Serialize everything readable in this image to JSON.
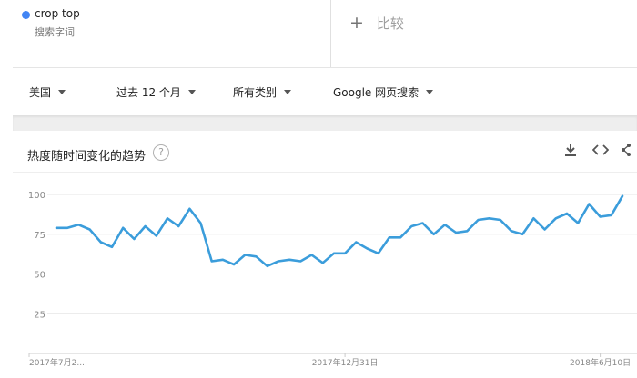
{
  "term": {
    "name": "crop top",
    "sub": "搜索字词",
    "color": "#4285f4"
  },
  "compare": {
    "plus": "+",
    "label": "比较"
  },
  "filters": [
    {
      "label": "美国"
    },
    {
      "label": "过去 12 个月"
    },
    {
      "label": "所有类别"
    },
    {
      "label": "Google 网页搜索"
    }
  ],
  "chart_header": {
    "title": "热度随时间变化的趋势",
    "help": "?"
  },
  "toolbar": {
    "download_icon": "download-icon",
    "embed_icon": "embed-code-icon",
    "share_icon": "share-icon"
  },
  "chart_data": {
    "type": "line",
    "title": "",
    "xlabel": "",
    "ylabel": "",
    "ylim": [
      0,
      100
    ],
    "yticks": [
      25,
      50,
      75,
      100
    ],
    "grid": true,
    "color": "#3b9ddb",
    "x_tick_labels": [
      {
        "label": "2017年7月2...",
        "index": 0
      },
      {
        "label": "2017年12月31日",
        "index": 26
      },
      {
        "label": "2018年6月10日",
        "index": 49
      }
    ],
    "series": [
      {
        "values": [
          79,
          79,
          81,
          78,
          70,
          67,
          79,
          72,
          80,
          74,
          85,
          80,
          91,
          82,
          58,
          59,
          56,
          62,
          61,
          55,
          58,
          59,
          58,
          62,
          57,
          63,
          63,
          70,
          66,
          63,
          73,
          73,
          80,
          82,
          75,
          81,
          76,
          77,
          84,
          85,
          84,
          77,
          75,
          85,
          78,
          85,
          88,
          82,
          94,
          86,
          87,
          99
        ]
      }
    ]
  }
}
